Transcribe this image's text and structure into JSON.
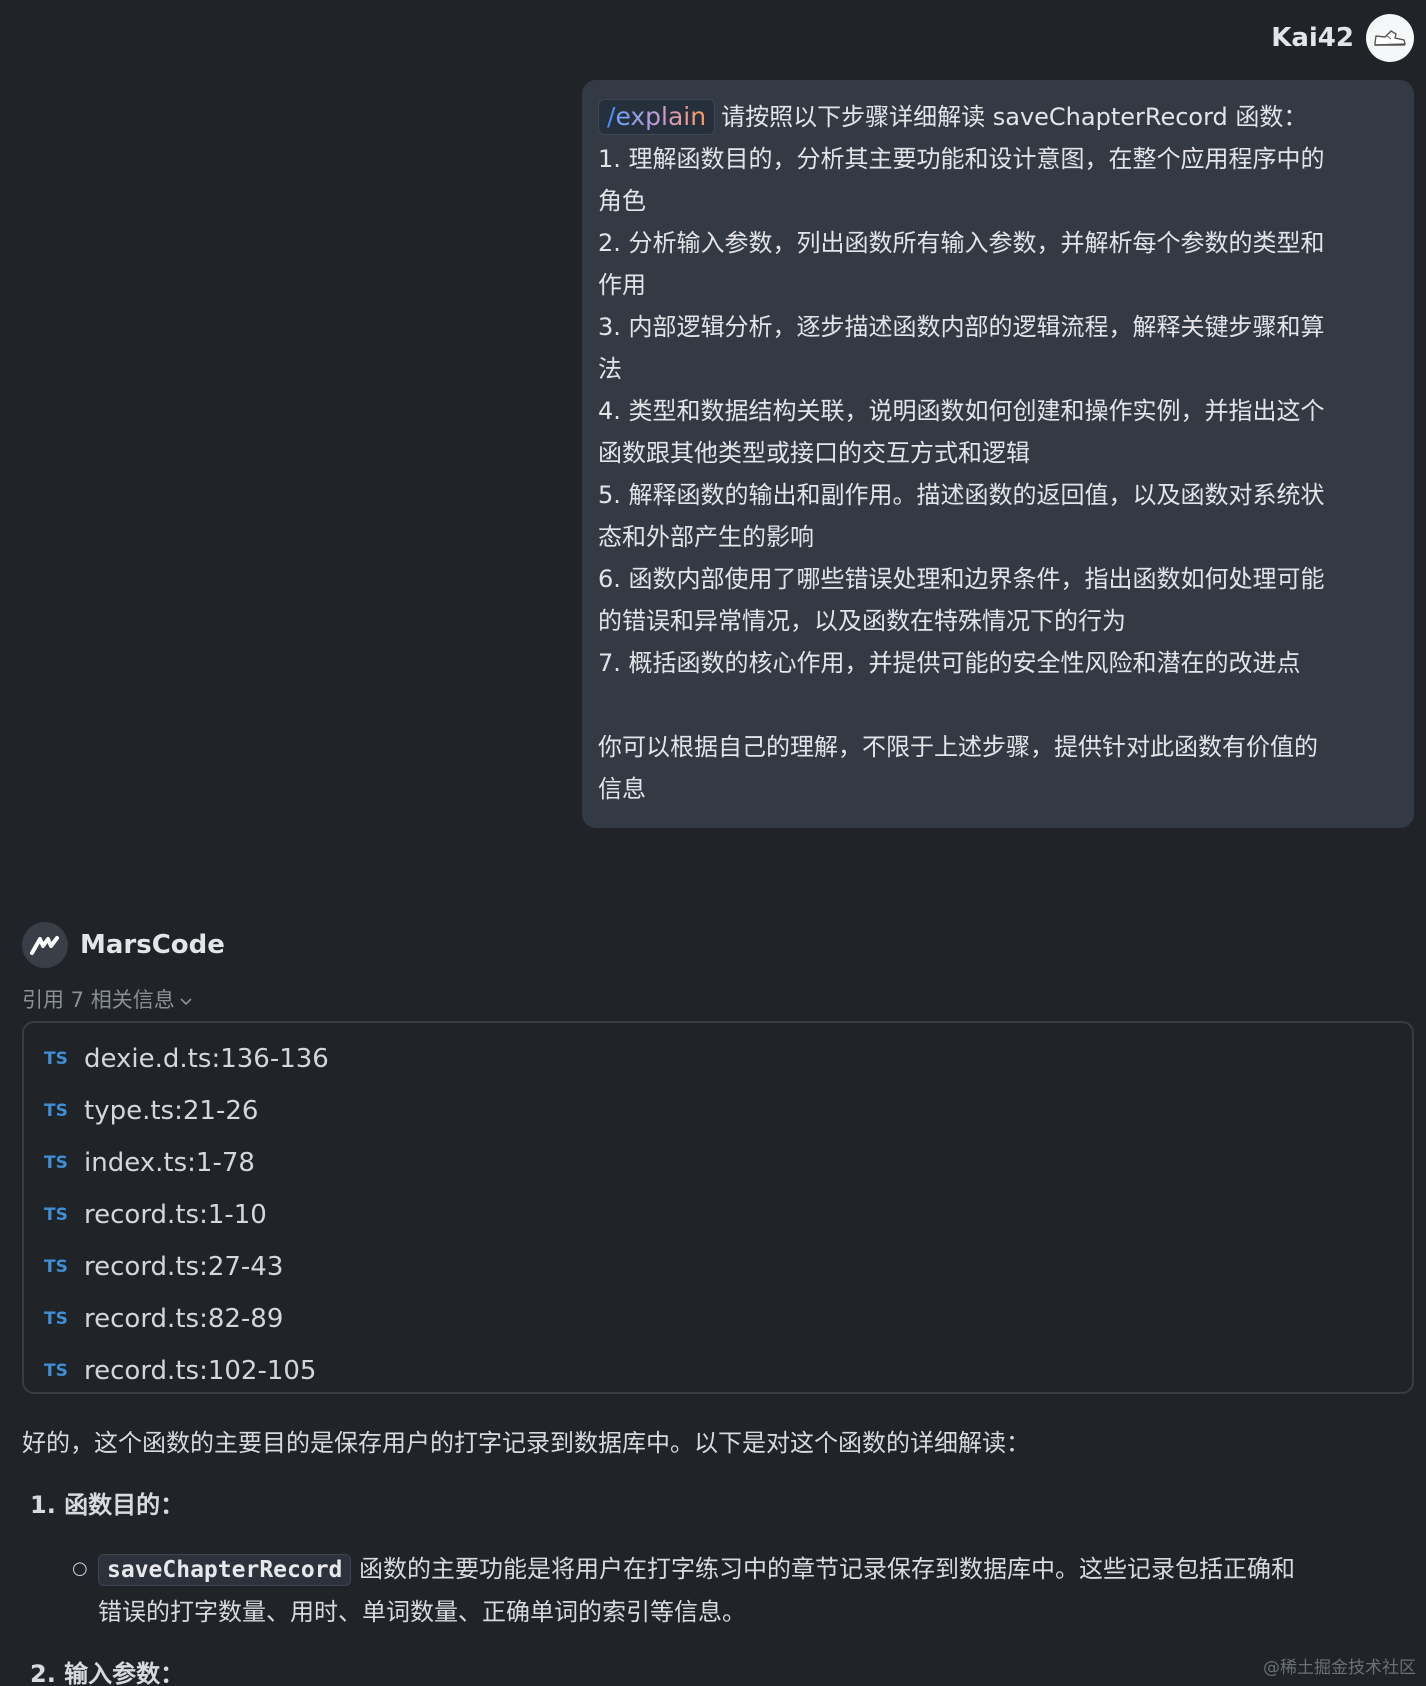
{
  "user": {
    "name": "Kai42",
    "avatar_icon": "user-avatar-sneaker-icon"
  },
  "user_message": {
    "command_slash": "/",
    "command_word": "explain",
    "lines": [
      "请按照以下步骤详细解读 saveChapterRecord 函数：",
      "1. 理解函数目的，分析其主要功能和设计意图，在整个应用程序中的",
      "角色",
      "2. 分析输入参数，列出函数所有输入参数，并解析每个参数的类型和",
      "作用",
      "3. 内部逻辑分析，逐步描述函数内部的逻辑流程，解释关键步骤和算",
      "法",
      "4. 类型和数据结构关联，说明函数如何创建和操作实例，并指出这个",
      "函数跟其他类型或接口的交互方式和逻辑",
      "5. 解释函数的输出和副作用。描述函数的返回值，以及函数对系统状",
      "态和外部产生的影响",
      "6. 函数内部使用了哪些错误处理和边界条件，指出函数如何处理可能",
      "的错误和异常情况，以及函数在特殊情况下的行为",
      "7. 概括函数的核心作用，并提供可能的安全性风险和潜在的改进点"
    ],
    "closing_lines": [
      "你可以根据自己的理解，不限于上述步骤，提供针对此函数有价值的",
      "信息"
    ]
  },
  "bot": {
    "name": "MarsCode",
    "avatar_icon": "marscode-logo-icon"
  },
  "references": {
    "toggle_label": "引用 7 相关信息",
    "badge": "TS",
    "items": [
      {
        "file": "dexie.d.ts",
        "range": ":136-136"
      },
      {
        "file": "type.ts",
        "range": ":21-26"
      },
      {
        "file": "index.ts",
        "range": ":1-78"
      },
      {
        "file": "record.ts",
        "range": ":1-10"
      },
      {
        "file": "record.ts",
        "range": ":27-43"
      },
      {
        "file": "record.ts",
        "range": ":82-89"
      },
      {
        "file": "record.ts",
        "range": ":102-105"
      }
    ]
  },
  "answer": {
    "intro": "好的，这个函数的主要目的是保存用户的打字记录到数据库中。以下是对这个函数的详细解读：",
    "section1_title": "1. 函数目的：",
    "section1_code": "saveChapterRecord",
    "section1_text_a": " 函数的主要功能是将用户在打字练习中的章节记录保存到数据库中。这些记录包括正确和",
    "section1_text_b": "错误的打字数量、用时、单词数量、正确单词的索引等信息。",
    "section2_title": "2. 输入参数："
  },
  "watermark": "@稀土掘金技术社区"
}
